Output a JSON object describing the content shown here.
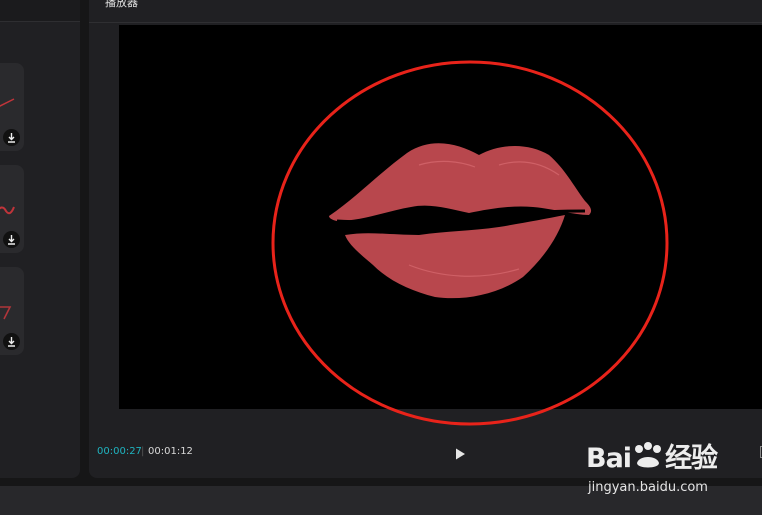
{
  "player": {
    "title": "播放器",
    "current_time": "00:00:27",
    "separator": "|",
    "total_time": "00:01:12"
  },
  "icons": {
    "play": "play-icon",
    "download": "download-icon",
    "fullscreen": "fullscreen-icon"
  },
  "watermark": {
    "brand_text": "Bai",
    "brand_suffix": "经验",
    "url": "jingyan.baidu.com"
  },
  "colors": {
    "accent_time": "#1fb3bf",
    "annotation_circle": "#e8231a",
    "lips": "#b8474d"
  }
}
